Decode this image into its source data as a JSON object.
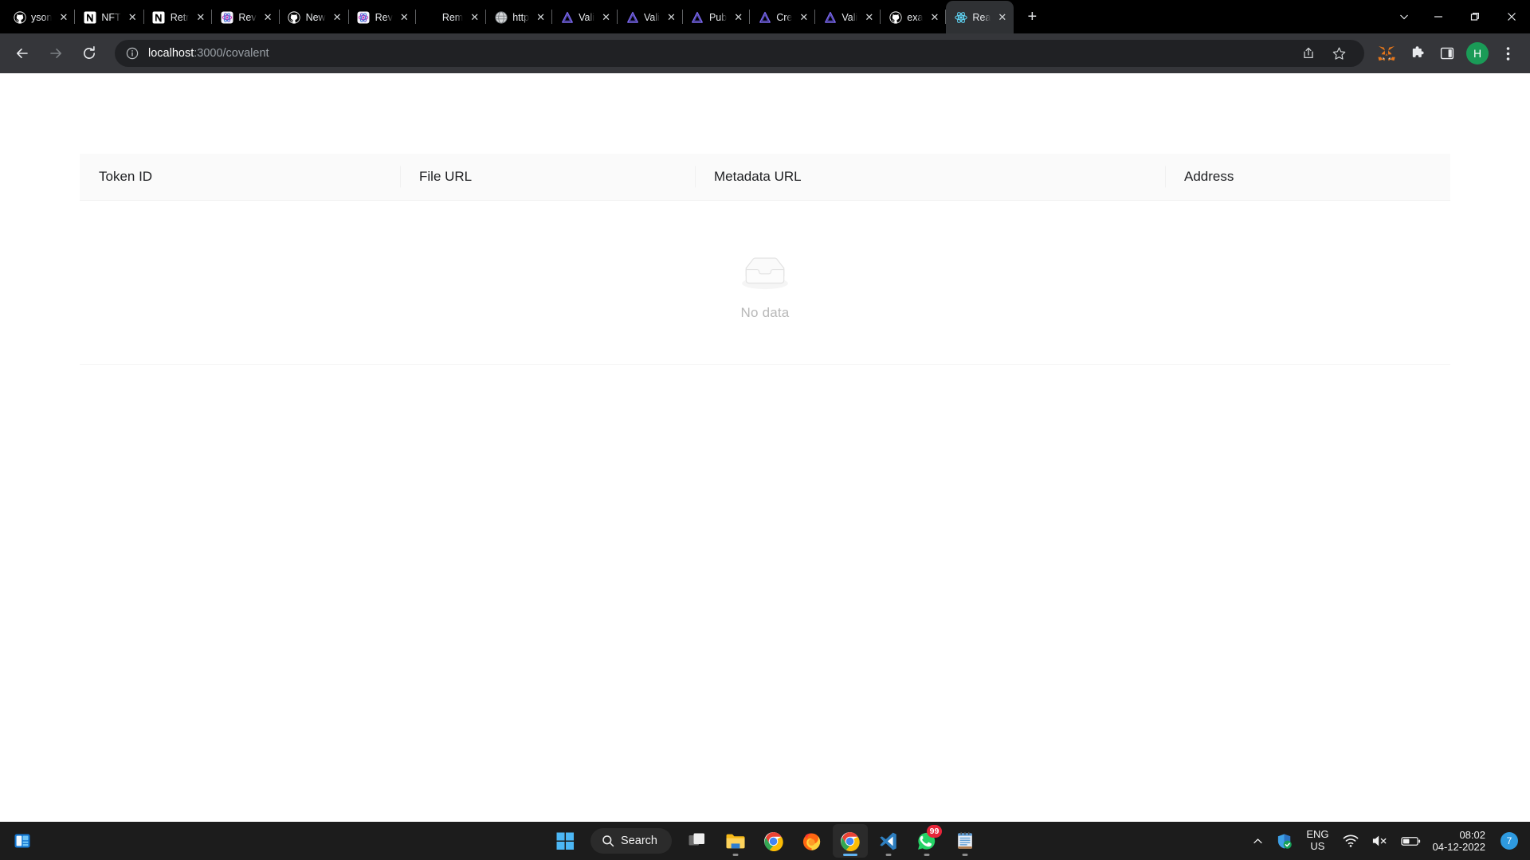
{
  "browser": {
    "tabs": [
      {
        "title": "yson",
        "favicon": "github-icon"
      },
      {
        "title": "NFT",
        "favicon": "notion-icon"
      },
      {
        "title": "Retr",
        "favicon": "notion-icon"
      },
      {
        "title": "Rev",
        "favicon": "revise-icon"
      },
      {
        "title": "New",
        "favicon": "github-icon"
      },
      {
        "title": "Rev",
        "favicon": "revise-icon"
      },
      {
        "title": "Rem",
        "favicon": "blank-icon"
      },
      {
        "title": "http",
        "favicon": "globe-icon"
      },
      {
        "title": "Vali",
        "favicon": "vercel-v-icon"
      },
      {
        "title": "Vali",
        "favicon": "vercel-v-icon"
      },
      {
        "title": "Pub",
        "favicon": "vercel-v-icon"
      },
      {
        "title": "Cre",
        "favicon": "vercel-v-icon"
      },
      {
        "title": "Vali",
        "favicon": "vercel-v-icon"
      },
      {
        "title": "exa",
        "favicon": "github-icon"
      },
      {
        "title": "Rea",
        "favicon": "react-icon",
        "active": true
      }
    ],
    "new_tab_label": "+",
    "tab_close_label": "✕",
    "window_controls": {
      "tab_search": "chevron-down-icon",
      "minimize": "minimize-icon",
      "maximize": "restore-icon",
      "close": "close-icon"
    },
    "toolbar": {
      "back": "back-arrow-icon",
      "forward": "forward-arrow-icon",
      "reload": "reload-icon",
      "site_info": "info-circle-icon",
      "url_host": "localhost",
      "url_rest": ":3000/covalent",
      "url_full": "localhost:3000/covalent",
      "share": "share-icon",
      "bookmark": "star-icon",
      "metamask": "metamask-fox-icon",
      "extensions": "puzzle-icon",
      "side_panel": "side-panel-icon",
      "profile_initial": "H",
      "menu": "three-dot-menu-icon"
    }
  },
  "page": {
    "table": {
      "columns": [
        "Token ID",
        "File URL",
        "Metadata URL",
        "Address"
      ],
      "rows": [],
      "empty_icon": "empty-inbox-icon",
      "empty_text": "No data"
    }
  },
  "taskbar": {
    "widgets": "widgets-icon",
    "start": "windows-start-icon",
    "search_label": "Search",
    "search_icon": "search-icon",
    "items": [
      {
        "name": "task-view",
        "icon": "task-view-icon"
      },
      {
        "name": "file-explorer",
        "icon": "folder-icon",
        "running": true
      },
      {
        "name": "chrome",
        "icon": "chrome-icon"
      },
      {
        "name": "firefox",
        "icon": "firefox-icon"
      },
      {
        "name": "chrome-active",
        "icon": "chrome-icon",
        "running": true,
        "active": true
      },
      {
        "name": "vs-code",
        "icon": "vscode-icon",
        "running": true
      },
      {
        "name": "whatsapp",
        "icon": "whatsapp-icon",
        "running": true,
        "badge": "99"
      },
      {
        "name": "notepad",
        "icon": "notepad-icon",
        "running": true
      }
    ],
    "tray": {
      "overflow": "chevron-up-icon",
      "defender": "shield-check-icon",
      "language_primary": "ENG",
      "language_secondary": "US",
      "wifi": "wifi-icon",
      "volume": "volume-muted-icon",
      "battery": "battery-icon",
      "time": "08:02",
      "date": "04-12-2022",
      "notifications_count": "7"
    }
  },
  "colors": {
    "tabstrip_bg": "#000000",
    "toolbar_bg": "#35363a",
    "omnibox_bg": "#202124",
    "active_tab_bg": "#2f3134",
    "page_bg": "#ffffff",
    "table_header_bg": "#fafafa",
    "empty_text": "#b8b8b8",
    "taskbar_bg": "#1c1c1c",
    "accent_blue": "#61b3f2",
    "badge_red": "#e8253a",
    "avatar_green": "#1a9b57"
  }
}
